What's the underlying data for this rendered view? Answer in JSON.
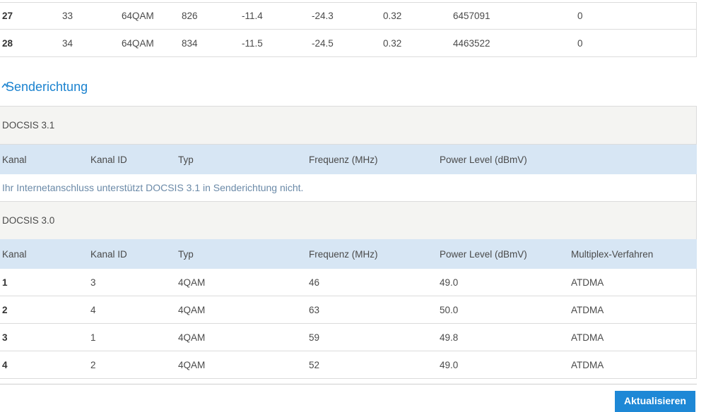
{
  "downstream_rows": [
    [
      "27",
      "33",
      "64QAM",
      "826",
      "-11.4",
      "-24.3",
      "0.32",
      "6457091",
      "0"
    ],
    [
      "28",
      "34",
      "64QAM",
      "834",
      "-11.5",
      "-24.5",
      "0.32",
      "4463522",
      "0"
    ]
  ],
  "upstream": {
    "heading": "Senderichtung",
    "docsis31": {
      "label": "DOCSIS 3.1",
      "columns": [
        "Kanal",
        "Kanal ID",
        "Typ",
        "Frequenz (MHz)",
        "Power Level (dBmV)"
      ],
      "message": "Ihr Internetanschluss unterstützt DOCSIS 3.1 in Senderichtung nicht."
    },
    "docsis30": {
      "label": "DOCSIS 3.0",
      "columns": [
        "Kanal",
        "Kanal ID",
        "Typ",
        "Frequenz (MHz)",
        "Power Level (dBmV)",
        "Multiplex-Verfahren"
      ],
      "rows": [
        [
          "1",
          "3",
          "4QAM",
          "46",
          "49.0",
          "ATDMA"
        ],
        [
          "2",
          "4",
          "4QAM",
          "63",
          "50.0",
          "ATDMA"
        ],
        [
          "3",
          "1",
          "4QAM",
          "59",
          "49.8",
          "ATDMA"
        ],
        [
          "4",
          "2",
          "4QAM",
          "52",
          "49.0",
          "ATDMA"
        ]
      ]
    }
  },
  "refresh_button": "Aktualisieren",
  "colors": {
    "accent": "#1a82cf",
    "header_bg": "#d7e6f4",
    "group_bg": "#f4f4f2",
    "button": "#1e88d6"
  }
}
